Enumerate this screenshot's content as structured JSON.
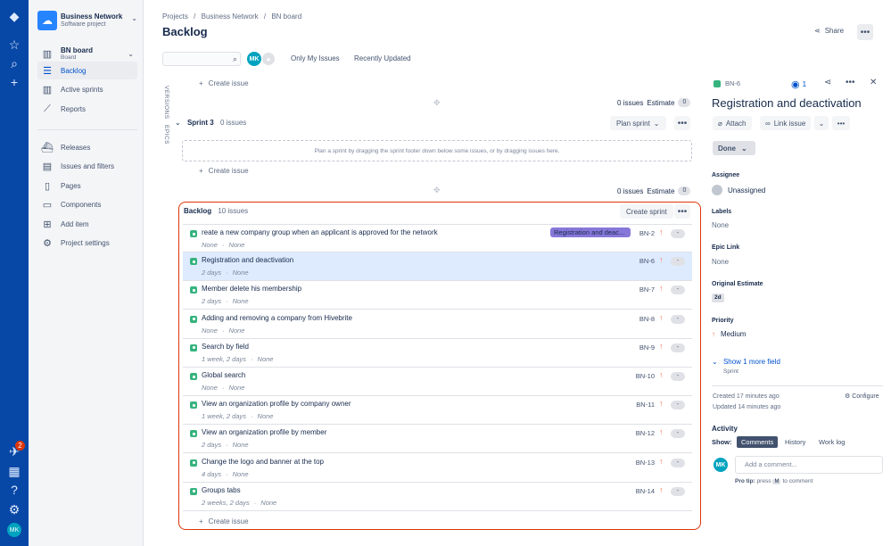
{
  "global_nav": {
    "notification_count": "2",
    "avatar_initials": "MK"
  },
  "project": {
    "name": "Business Network",
    "type": "Software project"
  },
  "sidebar": {
    "board": {
      "title": "BN board",
      "subtitle": "Board"
    },
    "items": [
      {
        "label": "Backlog"
      },
      {
        "label": "Active sprints"
      },
      {
        "label": "Reports"
      },
      {
        "label": "Releases"
      },
      {
        "label": "Issues and filters"
      },
      {
        "label": "Pages"
      },
      {
        "label": "Components"
      },
      {
        "label": "Add item"
      },
      {
        "label": "Project settings"
      }
    ]
  },
  "breadcrumb": [
    "Projects",
    "/",
    "Business Network",
    "/",
    "BN board"
  ],
  "page_title": "Backlog",
  "share_label": "Share",
  "filters": {
    "avatar_initials": "MK",
    "only_my_issues": "Only My Issues",
    "recently_updated": "Recently Updated"
  },
  "side_tabs": {
    "versions": "VERSIONS",
    "epics": "EPICS"
  },
  "create_issue": "Create issue",
  "summary_top": {
    "issues": "0 issues",
    "estimate_label": "Estimate",
    "estimate": "0"
  },
  "sprint": {
    "name": "Sprint 3",
    "count": "0 issues",
    "plan_button": "Plan sprint",
    "empty_hint": "Plan a sprint by dragging the sprint footer down below some issues, or by dragging issues here.",
    "issues": "0 issues",
    "estimate_label": "Estimate",
    "estimate": "0"
  },
  "backlog": {
    "title": "Backlog",
    "count": "10 issues",
    "create_sprint": "Create sprint",
    "issues": [
      {
        "summary": "reate a new company group when an applicant is approved for the network",
        "time": "None",
        "sprint": "None",
        "epic": "Registration and deac...",
        "key": "BN-2",
        "estimate": "-"
      },
      {
        "summary": "Registration and deactivation",
        "time": "2 days",
        "sprint": "None",
        "epic": "",
        "key": "BN-6",
        "estimate": "-"
      },
      {
        "summary": "Member delete his membership",
        "time": "2 days",
        "sprint": "None",
        "epic": "",
        "key": "BN-7",
        "estimate": "-"
      },
      {
        "summary": "Adding and removing a company from Hivebrite",
        "time": "None",
        "sprint": "None",
        "epic": "",
        "key": "BN-8",
        "estimate": "-"
      },
      {
        "summary": "Search by field",
        "time": "1 week, 2 days",
        "sprint": "None",
        "epic": "",
        "key": "BN-9",
        "estimate": "-"
      },
      {
        "summary": "Global search",
        "time": "None",
        "sprint": "None",
        "epic": "",
        "key": "BN-10",
        "estimate": "-"
      },
      {
        "summary": "View an organization profile by company owner",
        "time": "1 week, 2 days",
        "sprint": "None",
        "epic": "",
        "key": "BN-11",
        "estimate": "-"
      },
      {
        "summary": "View an organization profile by member",
        "time": "2 days",
        "sprint": "None",
        "epic": "",
        "key": "BN-12",
        "estimate": "-"
      },
      {
        "summary": "Change the logo and banner at the top",
        "time": "4 days",
        "sprint": "None",
        "epic": "",
        "key": "BN-13",
        "estimate": "-"
      },
      {
        "summary": "Groups tabs",
        "time": "2 weeks, 2 days",
        "sprint": "None",
        "epic": "",
        "key": "BN-14",
        "estimate": "-"
      }
    ]
  },
  "detail": {
    "key": "BN-6",
    "watchers": "1",
    "title": "Registration and deactivation",
    "attach": "Attach",
    "link_issue": "Link issue",
    "status": "Done",
    "assignee_label": "Assignee",
    "assignee": "Unassigned",
    "labels_label": "Labels",
    "labels": "None",
    "epic_label": "Epic Link",
    "epic": "None",
    "estimate_label": "Original Estimate",
    "estimate": "2d",
    "priority_label": "Priority",
    "priority": "Medium",
    "show_more": "Show 1 more field",
    "show_more_sub": "Sprint",
    "created": "Created 17 minutes ago",
    "updated": "Updated 14 minutes ago",
    "configure": "Configure",
    "activity_label": "Activity",
    "show_label": "Show:",
    "tabs": [
      "Comments",
      "History",
      "Work log"
    ],
    "avatar_initials": "MK",
    "comment_placeholder": "Add a comment...",
    "tip_label": "Pro tip:",
    "tip_text_1": "press",
    "tip_key": "M",
    "tip_text_2": "to comment"
  },
  "colors": {
    "nav": "#0747a6",
    "accent": "#0052cc",
    "story": "#36b37e",
    "epic": "#8777d9",
    "highlight": "#de350b"
  }
}
